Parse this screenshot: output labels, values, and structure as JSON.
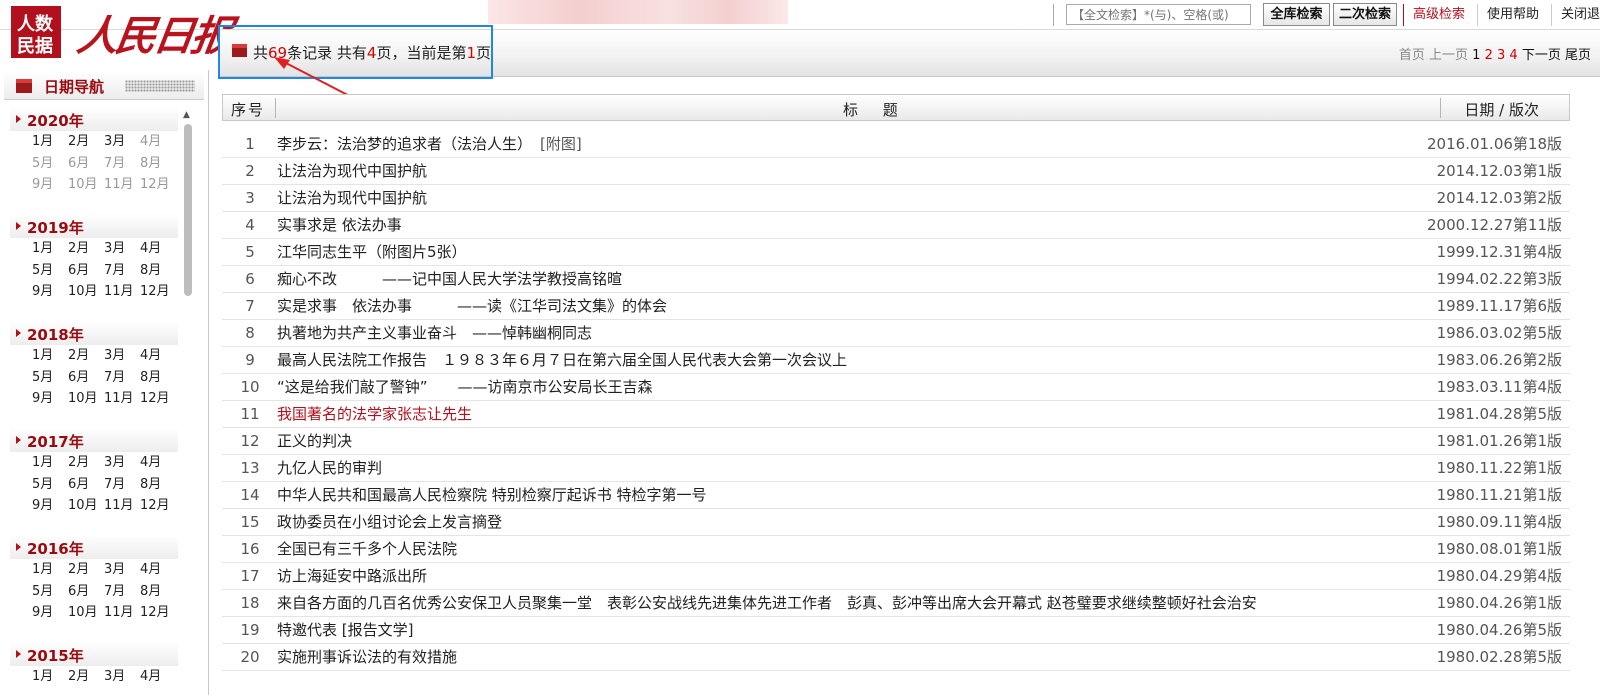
{
  "top": {
    "search_placeholder": "【全文检索】*(与)、空格(或)",
    "btn_full": "全库检索",
    "btn_second": "二次检索",
    "link_advanced": "高级检索",
    "link_help": "使用帮助",
    "link_close": "关闭退"
  },
  "logo": {
    "box_text": "人民数据",
    "masthead": "人民日报"
  },
  "result": {
    "prefix": "共",
    "total": "69",
    "mid1": "条记录 共有",
    "pages": "4",
    "mid2": "页，当前是第",
    "current": "1",
    "suffix": "页"
  },
  "pager": {
    "first": "首页",
    "prev": "上一页",
    "p1": "1",
    "p2": "2",
    "p3": "3",
    "p4": "4",
    "next": "下一页",
    "last": "尾页"
  },
  "sidebar": {
    "title": "日期导航",
    "years": [
      {
        "label": "2020年",
        "months": [
          "1月",
          "2月",
          "3月",
          "4月",
          "5月",
          "6月",
          "7月",
          "8月",
          "9月",
          "10月",
          "11月",
          "12月"
        ],
        "dim_from": 3
      },
      {
        "label": "2019年",
        "months": [
          "1月",
          "2月",
          "3月",
          "4月",
          "5月",
          "6月",
          "7月",
          "8月",
          "9月",
          "10月",
          "11月",
          "12月"
        ],
        "dim_from": 12
      },
      {
        "label": "2018年",
        "months": [
          "1月",
          "2月",
          "3月",
          "4月",
          "5月",
          "6月",
          "7月",
          "8月",
          "9月",
          "10月",
          "11月",
          "12月"
        ],
        "dim_from": 12
      },
      {
        "label": "2017年",
        "months": [
          "1月",
          "2月",
          "3月",
          "4月",
          "5月",
          "6月",
          "7月",
          "8月",
          "9月",
          "10月",
          "11月",
          "12月"
        ],
        "dim_from": 12
      },
      {
        "label": "2016年",
        "months": [
          "1月",
          "2月",
          "3月",
          "4月",
          "5月",
          "6月",
          "7月",
          "8月",
          "9月",
          "10月",
          "11月",
          "12月"
        ],
        "dim_from": 12
      },
      {
        "label": "2015年",
        "months": [
          "1月",
          "2月",
          "3月",
          "4月"
        ],
        "dim_from": 12
      }
    ]
  },
  "table": {
    "headers": {
      "num": "序号",
      "title": "标 题",
      "date": "日期 / 版次"
    },
    "rows": [
      {
        "num": "1",
        "title": "李步云：法治梦的追求者（法治人生）",
        "tag": "[附图]",
        "date": "2016.01.06第18版"
      },
      {
        "num": "2",
        "title": "让法治为现代中国护航",
        "date": "2014.12.03第1版"
      },
      {
        "num": "3",
        "title": "让法治为现代中国护航",
        "date": "2014.12.03第2版"
      },
      {
        "num": "4",
        "title": "实事求是 依法办事",
        "date": "2000.12.27第11版"
      },
      {
        "num": "5",
        "title": "江华同志生平（附图片5张）",
        "date": "1999.12.31第4版"
      },
      {
        "num": "6",
        "title": "痴心不改　　　——记中国人民大学法学教授高铭暄",
        "date": "1994.02.22第3版"
      },
      {
        "num": "7",
        "title": "实是求事　依法办事　　　——读《江华司法文集》的体会",
        "date": "1989.11.17第6版"
      },
      {
        "num": "8",
        "title": "执著地为共产主义事业奋斗　——悼韩幽桐同志",
        "date": "1986.03.02第5版"
      },
      {
        "num": "9",
        "title": "最高人民法院工作报告　１９８３年６月７日在第六届全国人民代表大会第一次会议上",
        "date": "1983.06.26第2版"
      },
      {
        "num": "10",
        "title": "“这是给我们敲了警钟”　　——访南京市公安局长王吉森",
        "date": "1983.03.11第4版"
      },
      {
        "num": "11",
        "title": "我国著名的法学家张志让先生",
        "date": "1981.04.28第5版",
        "visited": true
      },
      {
        "num": "12",
        "title": "正义的判决",
        "date": "1981.01.26第1版"
      },
      {
        "num": "13",
        "title": "九亿人民的审判",
        "date": "1980.11.22第1版"
      },
      {
        "num": "14",
        "title": "中华人民共和国最高人民检察院 特别检察厅起诉书 特检字第一号",
        "date": "1980.11.21第1版"
      },
      {
        "num": "15",
        "title": "政协委员在小组讨论会上发言摘登",
        "date": "1980.09.11第4版"
      },
      {
        "num": "16",
        "title": "全国已有三千多个人民法院",
        "date": "1980.08.01第1版"
      },
      {
        "num": "17",
        "title": "访上海延安中路派出所",
        "date": "1980.04.29第4版"
      },
      {
        "num": "18",
        "title": "来自各方面的几百名优秀公安保卫人员聚集一堂　表彰公安战线先进集体先进工作者　彭真、彭冲等出席大会开幕式 赵苍璧要求继续整顿好社会治安",
        "date": "1980.04.26第1版"
      },
      {
        "num": "19",
        "title": "特邀代表  [报告文学]",
        "date": "1980.04.26第5版"
      },
      {
        "num": "20",
        "title": "实施刑事诉讼法的有效措施",
        "date": "1980.02.28第5版"
      }
    ]
  }
}
